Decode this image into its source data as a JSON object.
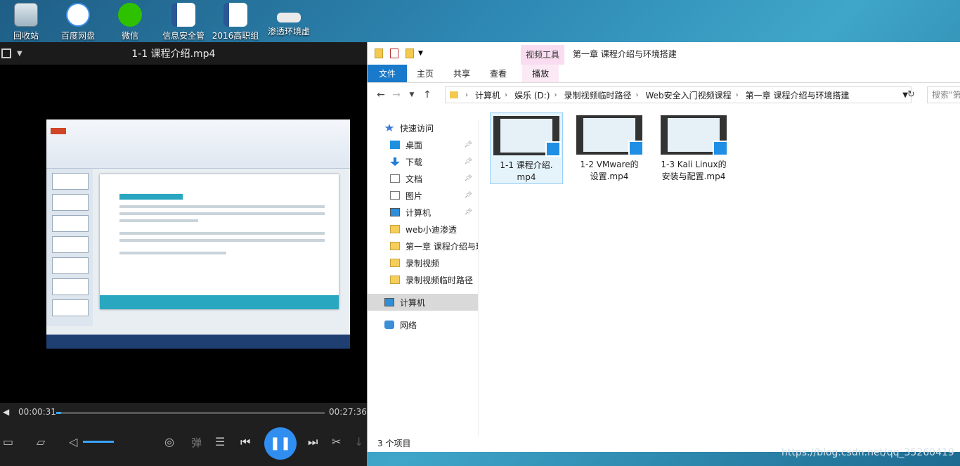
{
  "desktop": {
    "icons": [
      {
        "label": "回收站",
        "icon": "recycle-bin-icon"
      },
      {
        "label": "百度网盘",
        "icon": "baidu-netdisk-icon"
      },
      {
        "label": "微信",
        "icon": "wechat-icon"
      },
      {
        "label": "信息安全管",
        "icon": "word-doc-icon"
      },
      {
        "label": "2016高职组",
        "icon": "word-doc-icon"
      },
      {
        "label": "渗透环境虚",
        "icon": "file-icon"
      }
    ]
  },
  "player": {
    "title": "1-1 课程介绍.mp4",
    "current_time": "00:00:31",
    "total_time": "00:27:36",
    "progress": 0.019,
    "danmaku_label": "弹"
  },
  "explorer": {
    "context_tab": "视频工具",
    "window_title": "第一章 课程介绍与环境搭建",
    "tabs": [
      "文件",
      "主页",
      "共享",
      "查看"
    ],
    "context_subtab": "播放",
    "address": [
      "计算机",
      "娱乐 (D:)",
      "录制视频临时路径",
      "Web安全入门视频课程",
      "第一章 课程介绍与环境搭建"
    ],
    "search_placeholder": "搜索\"第",
    "nav": [
      {
        "label": "快速访问",
        "icon": "star-icon",
        "pinned": false
      },
      {
        "label": "桌面",
        "icon": "desktop-icon",
        "pinned": true
      },
      {
        "label": "下载",
        "icon": "download-icon",
        "pinned": true
      },
      {
        "label": "文档",
        "icon": "document-icon",
        "pinned": true
      },
      {
        "label": "图片",
        "icon": "pictures-icon",
        "pinned": true
      },
      {
        "label": "计算机",
        "icon": "computer-icon",
        "pinned": true
      },
      {
        "label": "web小迪渗透",
        "icon": "folder-icon",
        "pinned": false
      },
      {
        "label": "第一章 课程介绍与环",
        "icon": "folder-icon",
        "pinned": false
      },
      {
        "label": "录制视频",
        "icon": "folder-icon",
        "pinned": false
      },
      {
        "label": "录制视频临时路径",
        "icon": "folder-icon",
        "pinned": false
      },
      {
        "label": "计算机",
        "icon": "computer-icon",
        "pinned": false,
        "selected": true
      },
      {
        "label": "网络",
        "icon": "network-icon",
        "pinned": false
      }
    ],
    "files": [
      {
        "line1": "1-1 课程介绍.",
        "line2": "mp4",
        "selected": true
      },
      {
        "line1": "1-2 VMware的",
        "line2": "设置.mp4",
        "selected": false
      },
      {
        "line1": "1-3 Kali Linux的",
        "line2": "安装与配置.mp4",
        "selected": false
      }
    ],
    "status": "3 个项目"
  },
  "watermark": "https://blog.csdn.net/qq_35260419"
}
